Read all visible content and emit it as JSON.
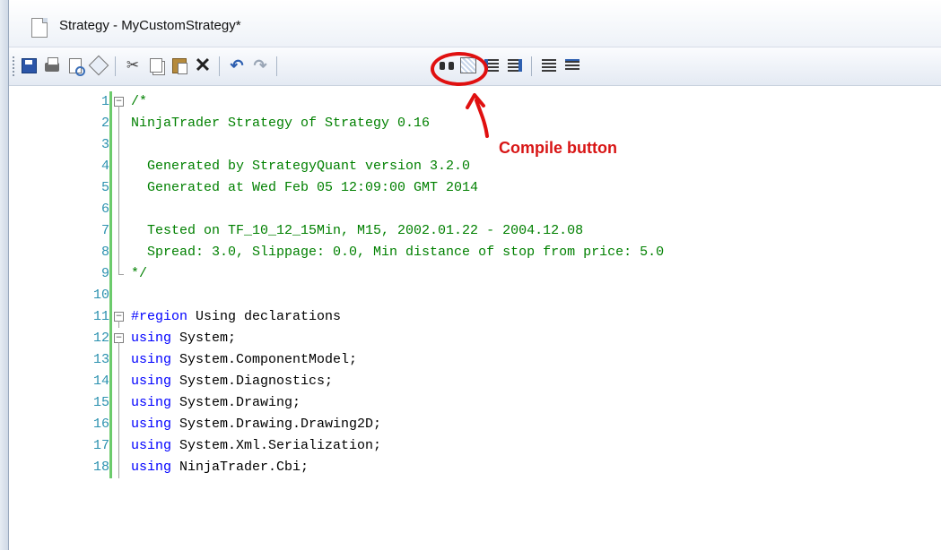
{
  "window": {
    "title": "Strategy - MyCustomStrategy*"
  },
  "toolbar": {
    "buttons": [
      {
        "name": "save-icon"
      },
      {
        "name": "print-icon"
      },
      {
        "name": "print-preview-icon"
      },
      {
        "name": "properties-icon"
      },
      {
        "name": "cut-icon"
      },
      {
        "name": "copy-icon"
      },
      {
        "name": "paste-icon"
      },
      {
        "name": "delete-icon"
      },
      {
        "name": "undo-icon"
      },
      {
        "name": "redo-icon"
      },
      {
        "name": "find-icon"
      },
      {
        "name": "compile-icon"
      },
      {
        "name": "indent-icon"
      },
      {
        "name": "outdent-icon"
      },
      {
        "name": "comment-lines-icon"
      },
      {
        "name": "uncomment-lines-icon"
      }
    ]
  },
  "annotation": {
    "label": "Compile button",
    "color": "#e01010"
  },
  "editor": {
    "lines": [
      {
        "n": "1",
        "text": "/*",
        "style": "comment"
      },
      {
        "n": "2",
        "text": "NinjaTrader Strategy of Strategy 0.16",
        "style": "comment"
      },
      {
        "n": "3",
        "text": "",
        "style": "comment"
      },
      {
        "n": "4",
        "text": "  Generated by StrategyQuant version 3.2.0",
        "style": "comment"
      },
      {
        "n": "5",
        "text": "  Generated at Wed Feb 05 12:09:00 GMT 2014",
        "style": "comment"
      },
      {
        "n": "6",
        "text": "",
        "style": "comment"
      },
      {
        "n": "7",
        "text": "  Tested on TF_10_12_15Min, M15, 2002.01.22 - 2004.12.08",
        "style": "comment"
      },
      {
        "n": "8",
        "text": "  Spread: 3.0, Slippage: 0.0, Min distance of stop from price: 5.0",
        "style": "comment"
      },
      {
        "n": "9",
        "text": "*/",
        "style": "comment"
      },
      {
        "n": "10",
        "text": "",
        "style": "plain"
      },
      {
        "n": "11",
        "kw": "#region",
        "text": " Using declarations",
        "style": "mixed"
      },
      {
        "n": "12",
        "kw": "using",
        "text": " System;",
        "style": "mixed"
      },
      {
        "n": "13",
        "kw": "using",
        "text": " System.ComponentModel;",
        "style": "mixed"
      },
      {
        "n": "14",
        "kw": "using",
        "text": " System.Diagnostics;",
        "style": "mixed"
      },
      {
        "n": "15",
        "kw": "using",
        "text": " System.Drawing;",
        "style": "mixed"
      },
      {
        "n": "16",
        "kw": "using",
        "text": " System.Drawing.Drawing2D;",
        "style": "mixed"
      },
      {
        "n": "17",
        "kw": "using",
        "text": " System.Xml.Serialization;",
        "style": "mixed"
      },
      {
        "n": "18",
        "kw": "using",
        "text": " NinjaTrader.Cbi;",
        "style": "mixed"
      }
    ]
  }
}
